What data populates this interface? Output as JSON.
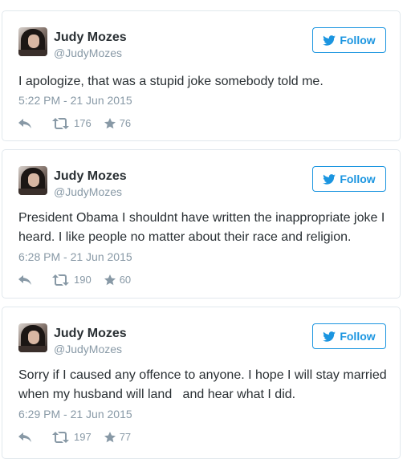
{
  "tweets": [
    {
      "name": "Judy Mozes",
      "handle": "@JudyMozes",
      "follow_label": "Follow",
      "text": "I apologize, that was a stupid joke somebody told me.",
      "timestamp": "5:22 PM - 21 Jun 2015",
      "retweets": "176",
      "likes": "76"
    },
    {
      "name": "Judy Mozes",
      "handle": "@JudyMozes",
      "follow_label": "Follow",
      "text": "President Obama I shouldnt have written the inappropriate joke I heard. I like people no matter about their race and religion.",
      "timestamp": "6:28 PM - 21 Jun 2015",
      "retweets": "190",
      "likes": "60"
    },
    {
      "name": "Judy Mozes",
      "handle": "@JudyMozes",
      "follow_label": "Follow",
      "text": "Sorry if I caused any offence to anyone. I hope I will stay married when my husband will land   and hear what I did.",
      "timestamp": "6:29 PM - 21 Jun 2015",
      "retweets": "197",
      "likes": "77"
    }
  ],
  "icons": {
    "follow": "twitter-bird-icon",
    "reply": "reply-icon",
    "retweet": "retweet-icon",
    "like": "star-icon"
  },
  "colors": {
    "accent": "#1b95e0",
    "muted": "#8899a6",
    "text": "#292f33",
    "border": "#e1e8ed"
  }
}
